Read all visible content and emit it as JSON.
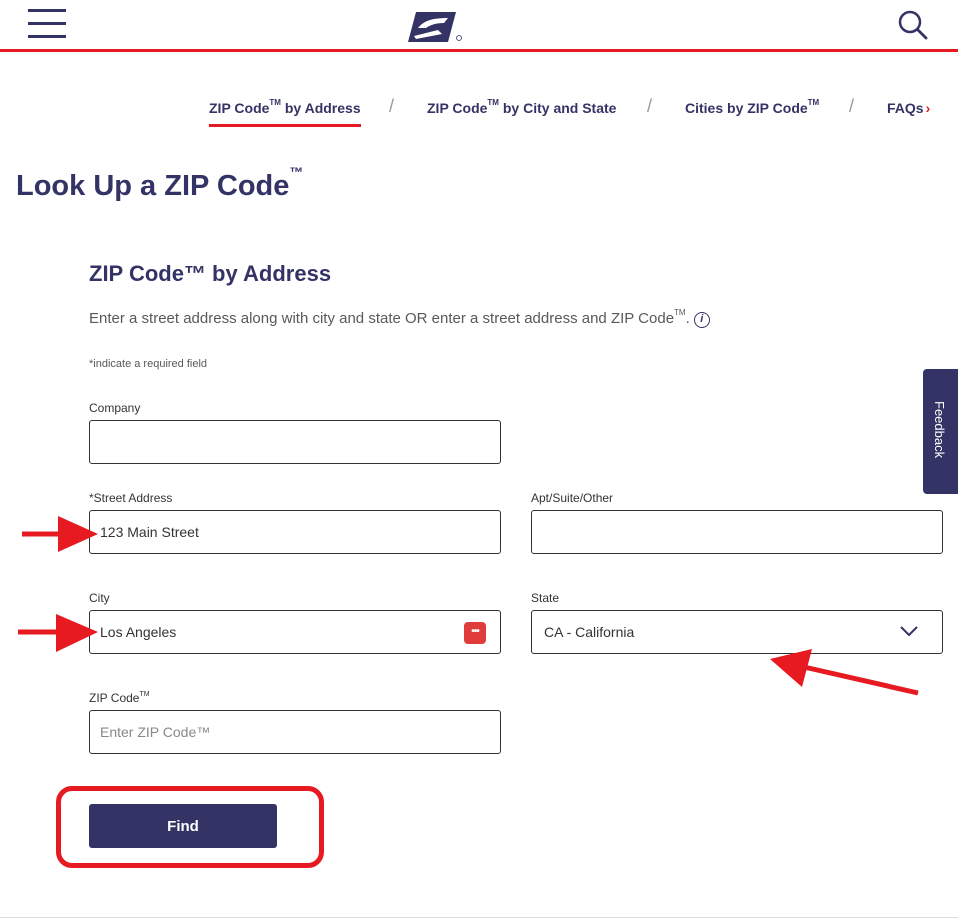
{
  "header": {
    "menu_icon": "hamburger-menu-icon",
    "logo_icon": "usps-eagle-logo",
    "search_icon": "search-icon",
    "accent_color": "#e71921",
    "brand_color": "#333366"
  },
  "tabs": [
    {
      "label": "ZIP Code",
      "tm": "TM",
      "suffix": " by Address",
      "active": true
    },
    {
      "label": "ZIP Code",
      "tm": "TM",
      "suffix": " by City and State",
      "active": false
    },
    {
      "label": "Cities by ZIP Code",
      "tm": "TM",
      "suffix": "",
      "active": false
    },
    {
      "label": "FAQs",
      "tm": "",
      "suffix": "",
      "active": false
    }
  ],
  "tab_separator": "/",
  "page_title": {
    "text": "Look Up a ZIP Code",
    "tm": "™"
  },
  "form": {
    "title": "ZIP Code™ by Address",
    "description": "Enter a street address along with city and state OR enter a street address and ZIP Code",
    "description_tm": "TM",
    "description_end": ".",
    "info_icon": "info-icon",
    "required_note": "*indicate a required field",
    "company": {
      "label": "Company",
      "value": ""
    },
    "street_address": {
      "label": "*Street Address",
      "value": "123 Main Street"
    },
    "apt": {
      "label": "Apt/Suite/Other",
      "value": ""
    },
    "city": {
      "label": "City",
      "value": "Los Angeles"
    },
    "state": {
      "label": "State",
      "value": "CA - California"
    },
    "zip": {
      "label": "ZIP Code",
      "label_tm": "TM",
      "value": "",
      "placeholder": "Enter ZIP Code™"
    },
    "find_button": "Find"
  },
  "feedback_tab": "Feedback",
  "annotations": {
    "arrow_color": "#e71921",
    "arrows": [
      "street-address-arrow",
      "city-arrow",
      "state-arrow"
    ],
    "highlight": "find-button-highlight"
  }
}
